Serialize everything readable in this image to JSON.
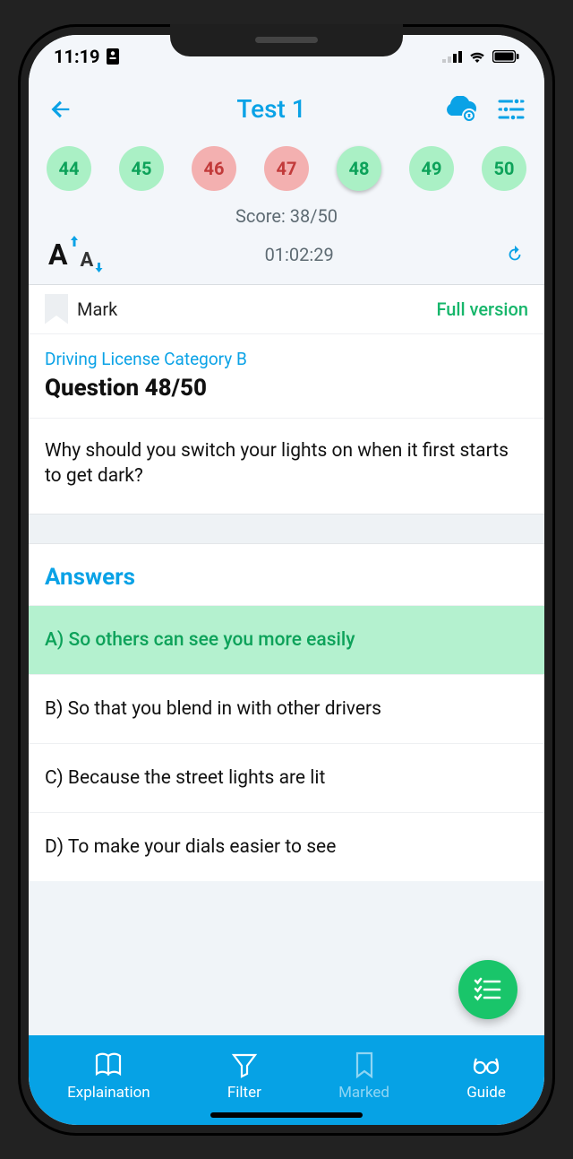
{
  "status": {
    "time": "11:19"
  },
  "nav": {
    "title": "Test 1"
  },
  "chips": [
    {
      "n": "44",
      "state": "green"
    },
    {
      "n": "45",
      "state": "green"
    },
    {
      "n": "46",
      "state": "red"
    },
    {
      "n": "47",
      "state": "red"
    },
    {
      "n": "48",
      "state": "green",
      "current": true
    },
    {
      "n": "49",
      "state": "green"
    },
    {
      "n": "50",
      "state": "green"
    }
  ],
  "score": {
    "label": "Score: 38/50"
  },
  "timer": {
    "value": "01:02:29"
  },
  "mark": {
    "label": "Mark",
    "full_version": "Full version"
  },
  "meta": {
    "category": "Driving License Category B",
    "qnum": "Question 48/50"
  },
  "question": {
    "text": "Why should you switch your lights on when it first starts to get dark?"
  },
  "answers": {
    "header": "Answers",
    "items": [
      {
        "text": "A) So others can see you more easily",
        "correct": true
      },
      {
        "text": "B) So that you blend in with other drivers"
      },
      {
        "text": "C) Because the street lights are lit"
      },
      {
        "text": "D) To make your dials easier to see"
      }
    ]
  },
  "bottom": {
    "explain": "Explaination",
    "filter": "Filter",
    "marked": "Marked",
    "guide": "Guide"
  }
}
